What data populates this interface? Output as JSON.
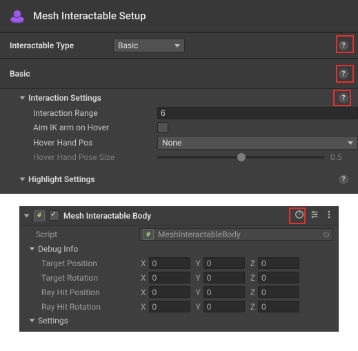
{
  "header": {
    "title": "Mesh Interactable Setup"
  },
  "typeRow": {
    "label": "Interactable Type",
    "dropdown": {
      "selected": "Basic"
    }
  },
  "basic": {
    "title": "Basic",
    "interaction": {
      "title": "Interaction Settings",
      "range": {
        "label": "Interaction Range",
        "value": "6"
      },
      "aimIK": {
        "label": "Aim IK arm on Hover",
        "checked": false
      },
      "hoverPos": {
        "label": "Hover Hand Pos",
        "selected": "None"
      },
      "hoverPose": {
        "label": "Hover Hand Pose Size",
        "value": "0.5",
        "pct": 50
      }
    },
    "highlight": {
      "title": "Highlight Settings"
    }
  },
  "component": {
    "title": "Mesh Interactable Body",
    "enabled": true,
    "script": {
      "label": "Script",
      "name": "MeshInteractableBody"
    },
    "debug": {
      "title": "Debug Info",
      "rows": [
        {
          "label": "Target Position",
          "x": "0",
          "y": "0",
          "z": "0"
        },
        {
          "label": "Target Rotation",
          "x": "0",
          "y": "0",
          "z": "0"
        },
        {
          "label": "Ray Hit Position",
          "x": "0",
          "y": "0",
          "z": "0"
        },
        {
          "label": "Ray Hit Rotation",
          "x": "0",
          "y": "0",
          "z": "0"
        }
      ]
    },
    "settings": {
      "title": "Settings"
    }
  },
  "axes": {
    "x": "X",
    "y": "Y",
    "z": "Z"
  },
  "icons": {
    "hash": "#"
  }
}
